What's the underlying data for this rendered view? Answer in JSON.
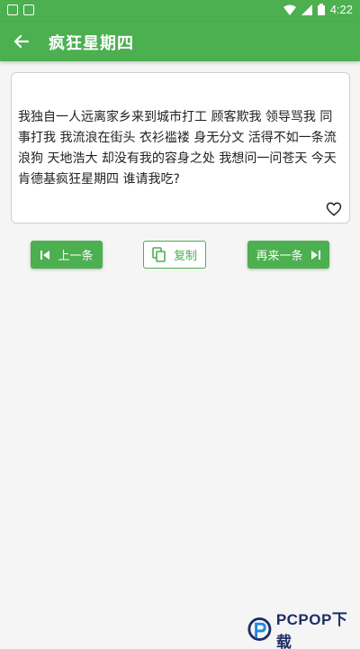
{
  "status_bar": {
    "time": "4:22",
    "icons": [
      "image-icon",
      "a-icon",
      "wifi-icon",
      "signal-icon",
      "battery-icon"
    ]
  },
  "app_bar": {
    "title": "疯狂星期四",
    "back_icon": "arrow-left-icon"
  },
  "content": {
    "text": "我独自一人远离家乡来到城市打工 顾客欺我 领导骂我 同事打我 我流浪在街头 衣衫褴褛 身无分文 活得不如一条流浪狗 天地浩大 却没有我的容身之处 我想问一问苍天 今天肯德基疯狂星期四 谁请我吃?",
    "favorite_icon": "heart-outline-icon"
  },
  "buttons": {
    "prev_label": "上一条",
    "copy_label": "复制",
    "next_label": "再来一条"
  },
  "watermark": {
    "text": "PCPOP下载"
  },
  "colors": {
    "primary": "#4caf50",
    "card_border": "#cfcfcf",
    "background": "#f5f5f5",
    "watermark": "#1c2e66"
  }
}
